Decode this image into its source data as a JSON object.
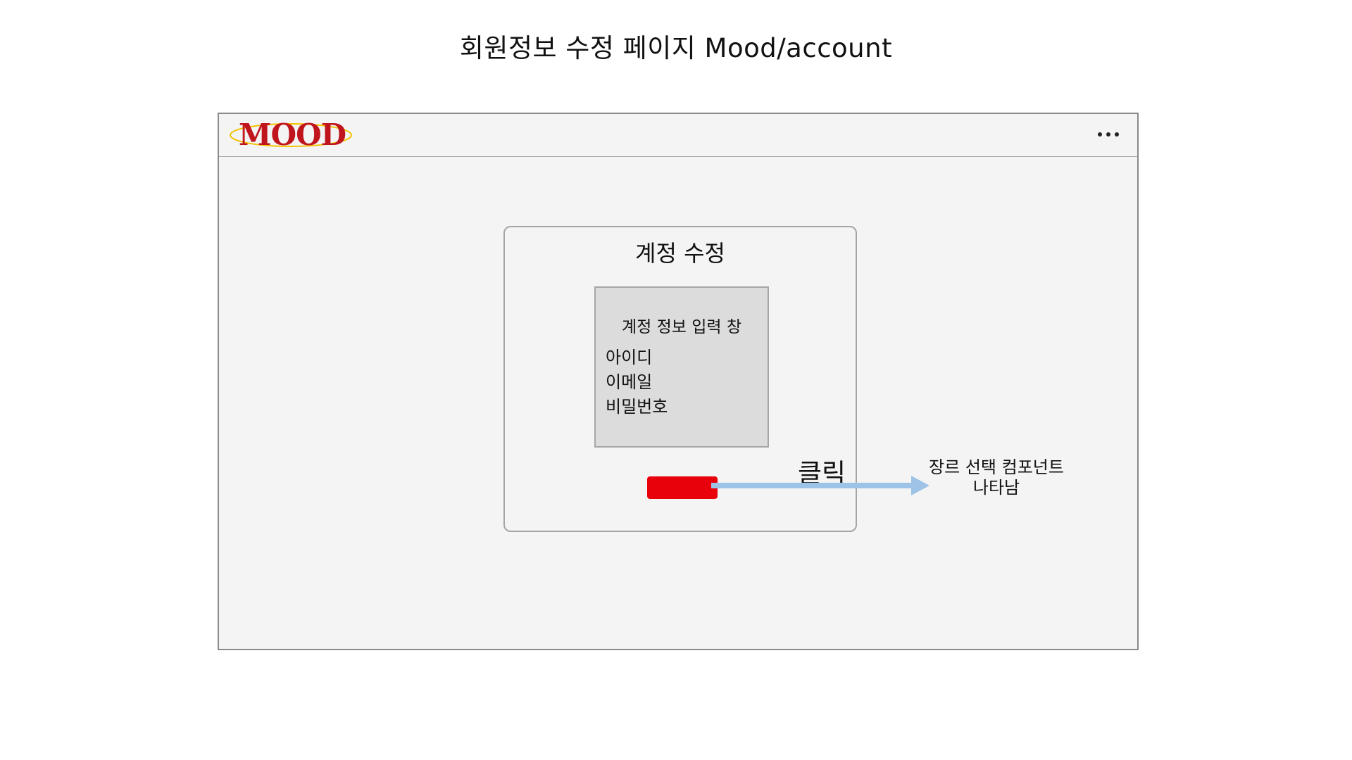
{
  "title": "회원정보 수정 페이지 Mood/account",
  "browser": {
    "logo_text": "MOOD",
    "more_icon": "more-horizontal-icon"
  },
  "dialog": {
    "title": "계정 수정",
    "input_panel": {
      "title": "계정 정보 입력 창",
      "fields": [
        "아이디",
        "이메일",
        "비밀번호"
      ]
    },
    "button_color": "#e8000b"
  },
  "annotation": {
    "click_label": "클릭",
    "result_line1": "장르 선택 컴포넌트",
    "result_line2": "나타남",
    "arrow_color": "#9dc3e6"
  }
}
